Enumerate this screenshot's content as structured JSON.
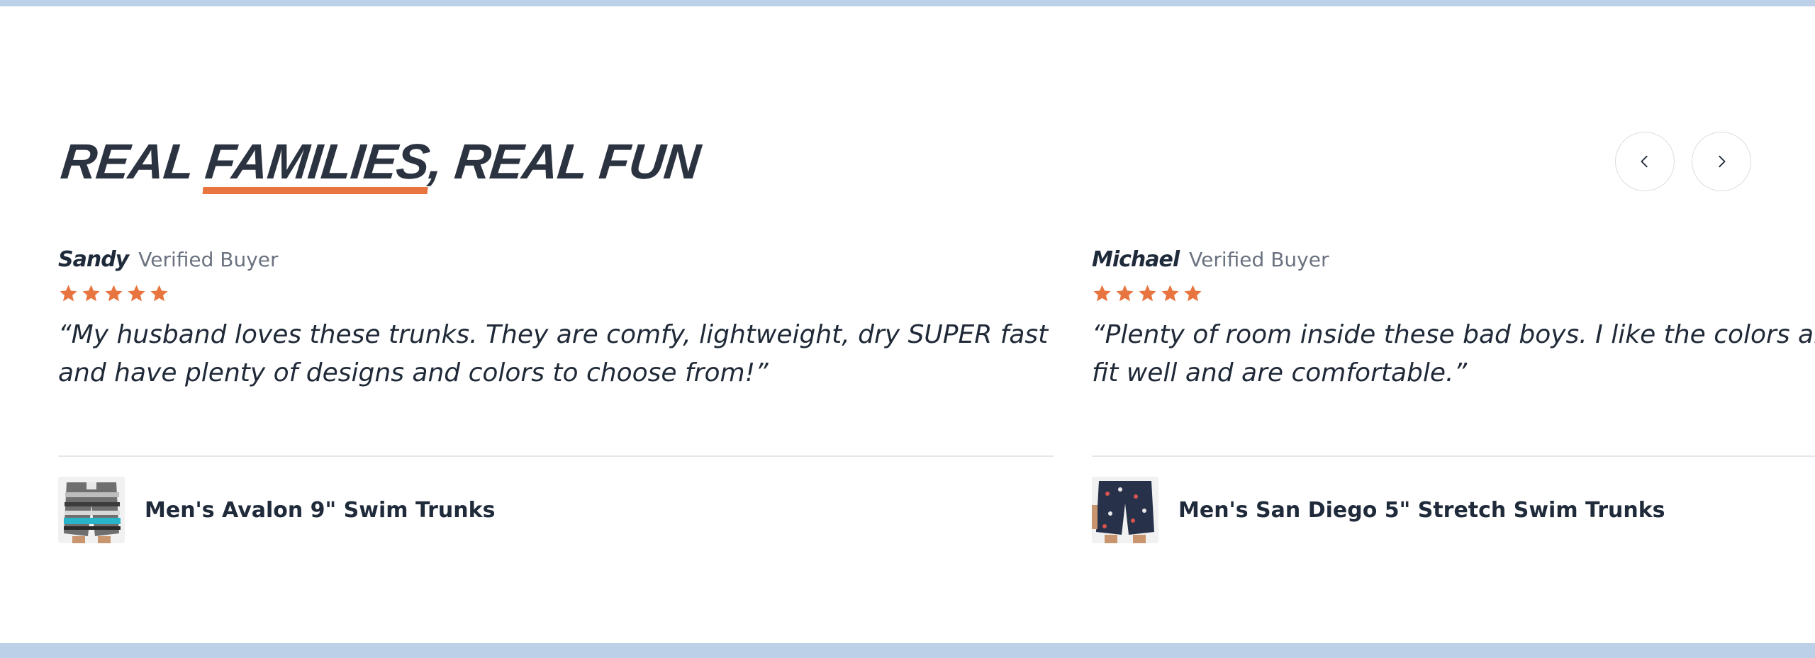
{
  "heading": {
    "part1": "REAL ",
    "highlight": "FAMILIES",
    "part2": ", REAL FUN",
    "underline_color": "#e8743f"
  },
  "carousel": {
    "prev_icon": "chevron-left-icon",
    "next_icon": "chevron-right-icon"
  },
  "reviews": [
    {
      "name": "Sandy",
      "badge": "Verified Buyer",
      "rating": 5,
      "max_rating": 5,
      "star_color": "#e8743f",
      "quote_line1": "“My husband loves these trunks. They are comfy, lightweight, dry SUPER fast",
      "quote_line2": "and have plenty of designs and colors to choose from!”",
      "product_name": "Men's Avalon 9\" Swim Trunks",
      "product_image": "striped-grey-teal-swim-trunks"
    },
    {
      "name": "Michael",
      "badge": "Verified Buyer",
      "rating": 5,
      "max_rating": 5,
      "star_color": "#e8743f",
      "quote_line1": "“Plenty of room inside these bad boys. I like the colors and",
      "quote_line2": "fit well and are comfortable.”",
      "product_name": "Men's San Diego 5\" Stretch Swim Trunks",
      "product_image": "navy-patterned-swim-trunks"
    }
  ],
  "theme": {
    "band_color": "#bcd0e8",
    "text_color": "#1f2937",
    "muted_color": "#6b7280"
  }
}
